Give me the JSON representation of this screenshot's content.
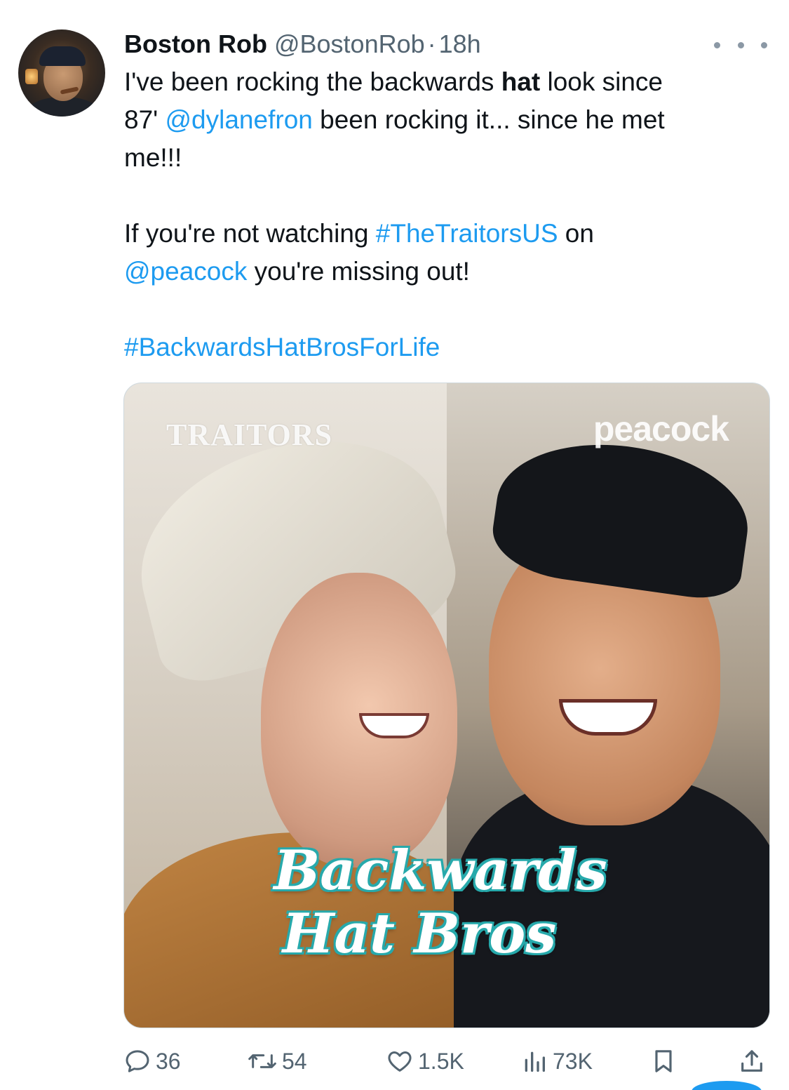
{
  "tweet": {
    "author_name": "Boston Rob",
    "author_handle": "@BostonRob",
    "separator": "·",
    "time": "18h",
    "lines": {
      "l1_a": "I've been rocking the backwards ",
      "l1_b": "hat",
      "l1_c": " look since",
      "l2_a": "87' ",
      "l2_b": "@dylanefron",
      "l2_c": " been rocking it... since he met",
      "l3": "me!!!",
      "l4_a": "If you're not watching ",
      "l4_b": "#TheTraitorsUS",
      "l4_c": " on",
      "l5_a": "@peacock",
      "l5_b": " you're missing out!",
      "l6": "#BackwardsHatBrosForLife"
    },
    "media": {
      "logo_left": "TRAITORS",
      "logo_right": "peacock",
      "caption_line1": "Backwards",
      "caption_line2": "Hat Bros"
    },
    "actions": {
      "replies": "36",
      "retweets": "54",
      "likes": "1.5K",
      "views": "73K"
    }
  },
  "colors": {
    "link": "#1d9bf0",
    "secondary_text": "#536471",
    "caption_accent": "#27a9ab"
  },
  "icons": [
    "more-icon",
    "reply-icon",
    "retweet-icon",
    "like-icon",
    "views-icon",
    "bookmark-icon",
    "share-icon"
  ]
}
